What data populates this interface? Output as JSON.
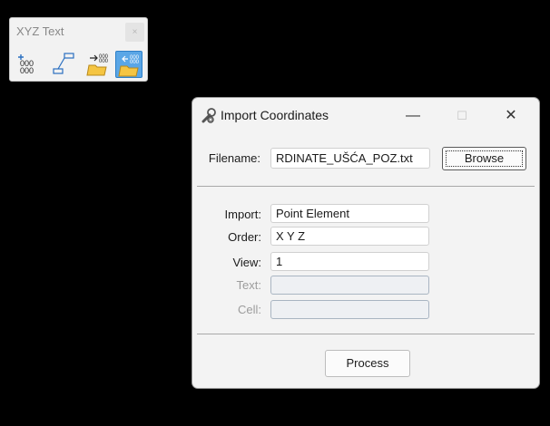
{
  "toolbox": {
    "title": "XYZ Text",
    "close_glyph": "×",
    "tools": [
      {
        "icon": "place-point-xyz-icon"
      },
      {
        "icon": "label-element-icon"
      },
      {
        "icon": "export-coordinates-icon"
      },
      {
        "icon": "import-coordinates-icon",
        "active": true
      }
    ]
  },
  "dialog": {
    "title": "Import Coordinates",
    "minimize_glyph": "—",
    "maximize_glyph": "☐",
    "close_glyph": "✕",
    "filename_label": "Filename:",
    "filename_value": "RDINATE_UŠĆA_POZ.txt",
    "browse_label": "Browse",
    "import_label": "Import:",
    "import_value": "Point Element",
    "order_label": "Order:",
    "order_value": "X Y Z",
    "view_label": "View:",
    "view_value": "1",
    "text_label": "Text:",
    "text_value": "",
    "cell_label": "Cell:",
    "cell_value": "",
    "process_label": "Process"
  },
  "colors": {
    "desktop": "#000000",
    "dialog_bg": "#f3f3f3",
    "active_tool": "#5aa6e6"
  }
}
